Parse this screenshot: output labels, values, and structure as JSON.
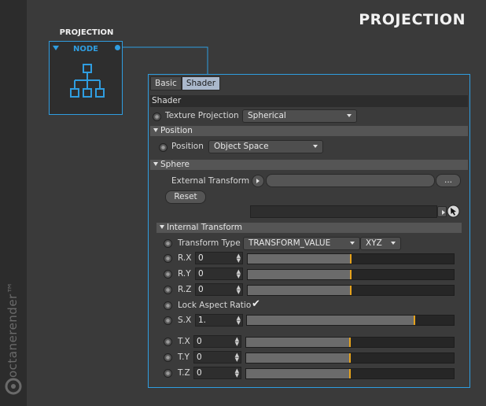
{
  "brand": {
    "text": "octanerender™"
  },
  "page_title": "PROJECTION",
  "node": {
    "caption": "PROJECTION",
    "label": "NODE"
  },
  "tabs": [
    {
      "label": "Basic",
      "active": false
    },
    {
      "label": "Shader",
      "active": true
    }
  ],
  "shader": {
    "section_title": "Shader",
    "texture_projection": {
      "label": "Texture Projection",
      "value": "Spherical"
    },
    "position_group": {
      "header": "Position",
      "label": "Position",
      "value": "Object Space"
    },
    "sphere_group": {
      "header": "Sphere",
      "external_transform_label": "External Transform",
      "ellipsis_label": "...",
      "reset_label": "Reset",
      "internal_transform": {
        "header": "Internal Transform",
        "transform_type_label": "Transform Type",
        "transform_type_value": "TRANSFORM_VALUE",
        "rotation_order_value": "XYZ",
        "rx": {
          "label": "R.X",
          "value": "0",
          "slider_fraction": 0.5
        },
        "ry": {
          "label": "R.Y",
          "value": "0",
          "slider_fraction": 0.5
        },
        "rz": {
          "label": "R.Z",
          "value": "0",
          "slider_fraction": 0.5
        },
        "lock_aspect": {
          "label": "Lock Aspect Ratio",
          "checked": true
        },
        "sx": {
          "label": "S.X",
          "value": "1.",
          "slider_fraction": 0.81
        },
        "tx": {
          "label": "T.X",
          "value": "0",
          "slider_fraction": 0.5
        },
        "ty": {
          "label": "T.Y",
          "value": "0",
          "slider_fraction": 0.5
        },
        "tz": {
          "label": "T.Z",
          "value": "0",
          "slider_fraction": 0.5
        }
      }
    }
  },
  "colors": {
    "accent": "#2f9de0",
    "slider_marker": "#e6a21b",
    "background": "#3a3a3a"
  }
}
